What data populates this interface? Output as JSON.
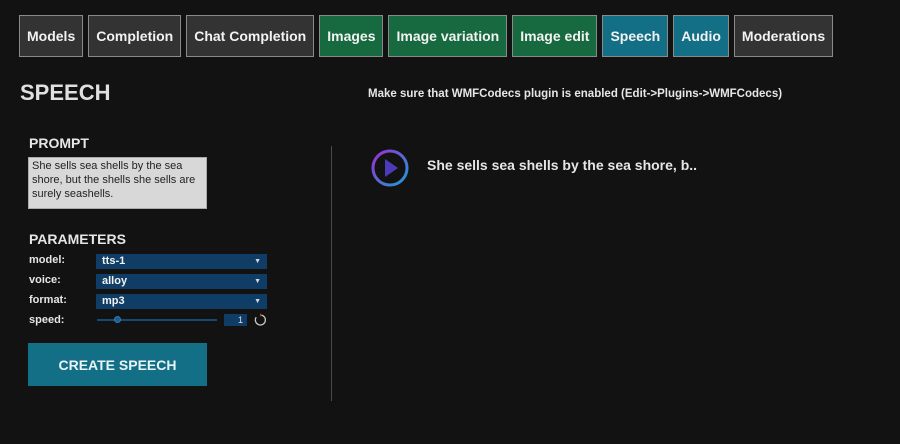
{
  "tabs": [
    {
      "label": "Models",
      "style": "gray"
    },
    {
      "label": "Completion",
      "style": "gray"
    },
    {
      "label": "Chat Completion",
      "style": "gray"
    },
    {
      "label": "Images",
      "style": "green"
    },
    {
      "label": "Image variation",
      "style": "green"
    },
    {
      "label": "Image edit",
      "style": "green"
    },
    {
      "label": "Speech",
      "style": "blue"
    },
    {
      "label": "Audio",
      "style": "blue"
    },
    {
      "label": "Moderations",
      "style": "gray"
    }
  ],
  "page": {
    "title": "SPEECH",
    "notice": "Make sure that WMFCodecs plugin is enabled (Edit->Plugins->WMFCodecs)"
  },
  "prompt": {
    "heading": "PROMPT",
    "text": "She sells sea shells by the sea shore, but the shells she sells are surely seashells."
  },
  "parameters": {
    "heading": "PARAMETERS",
    "model": {
      "label": "model:",
      "value": "tts-1"
    },
    "voice": {
      "label": "voice:",
      "value": "alloy"
    },
    "format": {
      "label": "format:",
      "value": "mp3"
    },
    "speed": {
      "label": "speed:",
      "value": "1",
      "slider_fraction": 0.17
    }
  },
  "create_button": "CREATE SPEECH",
  "result": {
    "text": "She sells sea shells by the sea shore, b..",
    "play_icon": "play-circle-icon"
  },
  "colors": {
    "gray_tab": "#333333",
    "green_tab": "#176a3f",
    "blue_tab": "#136f86",
    "select_bg": "#0f3d66"
  }
}
